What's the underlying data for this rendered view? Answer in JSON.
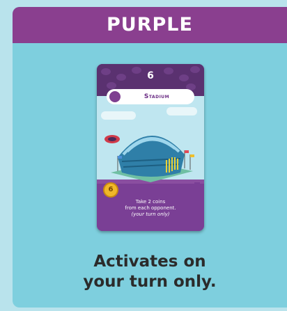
{
  "header": {
    "title": "PURPLE"
  },
  "card": {
    "cost": "6",
    "name": "Stadium",
    "activation_number": "6",
    "effect_line1": "Take 2 coins",
    "effect_line2": "from each opponent.",
    "effect_note": "(your turn only)"
  },
  "caption": {
    "line1": "Activates on",
    "line2": "your turn only."
  },
  "colors": {
    "header_purple": "#8a3f8f",
    "panel_teal": "#7ecfde",
    "page_light": "#b9e3ec",
    "coin_gold": "#f0b729"
  }
}
